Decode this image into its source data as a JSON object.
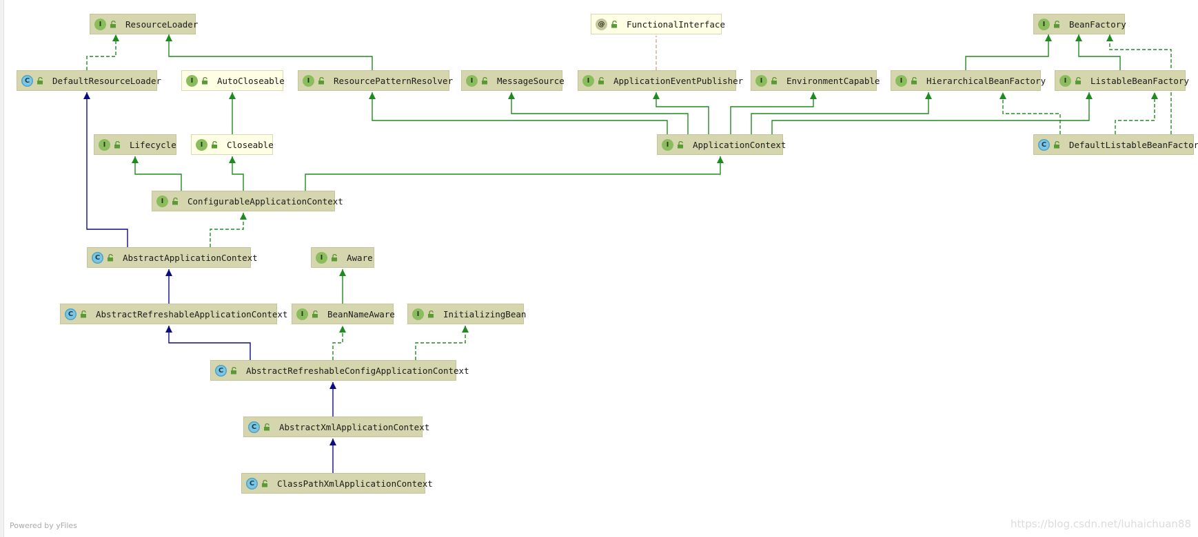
{
  "diagram": {
    "nodes": [
      {
        "id": "ResourceLoader",
        "label": "ResourceLoader",
        "kind": "I"
      },
      {
        "id": "FunctionalInterface",
        "label": "FunctionalInterface",
        "kind": "@"
      },
      {
        "id": "BeanFactory",
        "label": "BeanFactory",
        "kind": "I"
      },
      {
        "id": "DefaultResourceLoader",
        "label": "DefaultResourceLoader",
        "kind": "C"
      },
      {
        "id": "AutoCloseable",
        "label": "AutoCloseable",
        "kind": "I"
      },
      {
        "id": "ResourcePatternResolver",
        "label": "ResourcePatternResolver",
        "kind": "I"
      },
      {
        "id": "MessageSource",
        "label": "MessageSource",
        "kind": "I"
      },
      {
        "id": "ApplicationEventPublisher",
        "label": "ApplicationEventPublisher",
        "kind": "I"
      },
      {
        "id": "EnvironmentCapable",
        "label": "EnvironmentCapable",
        "kind": "I"
      },
      {
        "id": "HierarchicalBeanFactory",
        "label": "HierarchicalBeanFactory",
        "kind": "I"
      },
      {
        "id": "ListableBeanFactory",
        "label": "ListableBeanFactory",
        "kind": "I"
      },
      {
        "id": "Lifecycle",
        "label": "Lifecycle",
        "kind": "I"
      },
      {
        "id": "Closeable",
        "label": "Closeable",
        "kind": "I"
      },
      {
        "id": "ApplicationContext",
        "label": "ApplicationContext",
        "kind": "I"
      },
      {
        "id": "DefaultListableBeanFactory",
        "label": "DefaultListableBeanFactory",
        "kind": "C"
      },
      {
        "id": "ConfigurableApplicationContext",
        "label": "ConfigurableApplicationContext",
        "kind": "I"
      },
      {
        "id": "AbstractApplicationContext",
        "label": "AbstractApplicationContext",
        "kind": "C"
      },
      {
        "id": "Aware",
        "label": "Aware",
        "kind": "I"
      },
      {
        "id": "AbstractRefreshableApplicationContext",
        "label": "AbstractRefreshableApplicationContext",
        "kind": "C"
      },
      {
        "id": "BeanNameAware",
        "label": "BeanNameAware",
        "kind": "I"
      },
      {
        "id": "InitializingBean",
        "label": "InitializingBean",
        "kind": "I"
      },
      {
        "id": "AbstractRefreshableConfigApplicationContext",
        "label": "AbstractRefreshableConfigApplicationContext",
        "kind": "C"
      },
      {
        "id": "AbstractXmlApplicationContext",
        "label": "AbstractXmlApplicationContext",
        "kind": "C"
      },
      {
        "id": "ClassPathXmlApplicationContext",
        "label": "ClassPathXmlApplicationContext",
        "kind": "C"
      }
    ]
  },
  "footer": {
    "powered_by": "Powered by yFiles",
    "watermark": "https://blog.csdn.net/luhaichuan88"
  },
  "colors": {
    "node_fill": "#d6d6ae",
    "node_fill_light": "#fefee4",
    "interface_edge": "#1f8a1f",
    "class_edge": "#0b0b82",
    "annotation_edge": "#c9a892"
  }
}
